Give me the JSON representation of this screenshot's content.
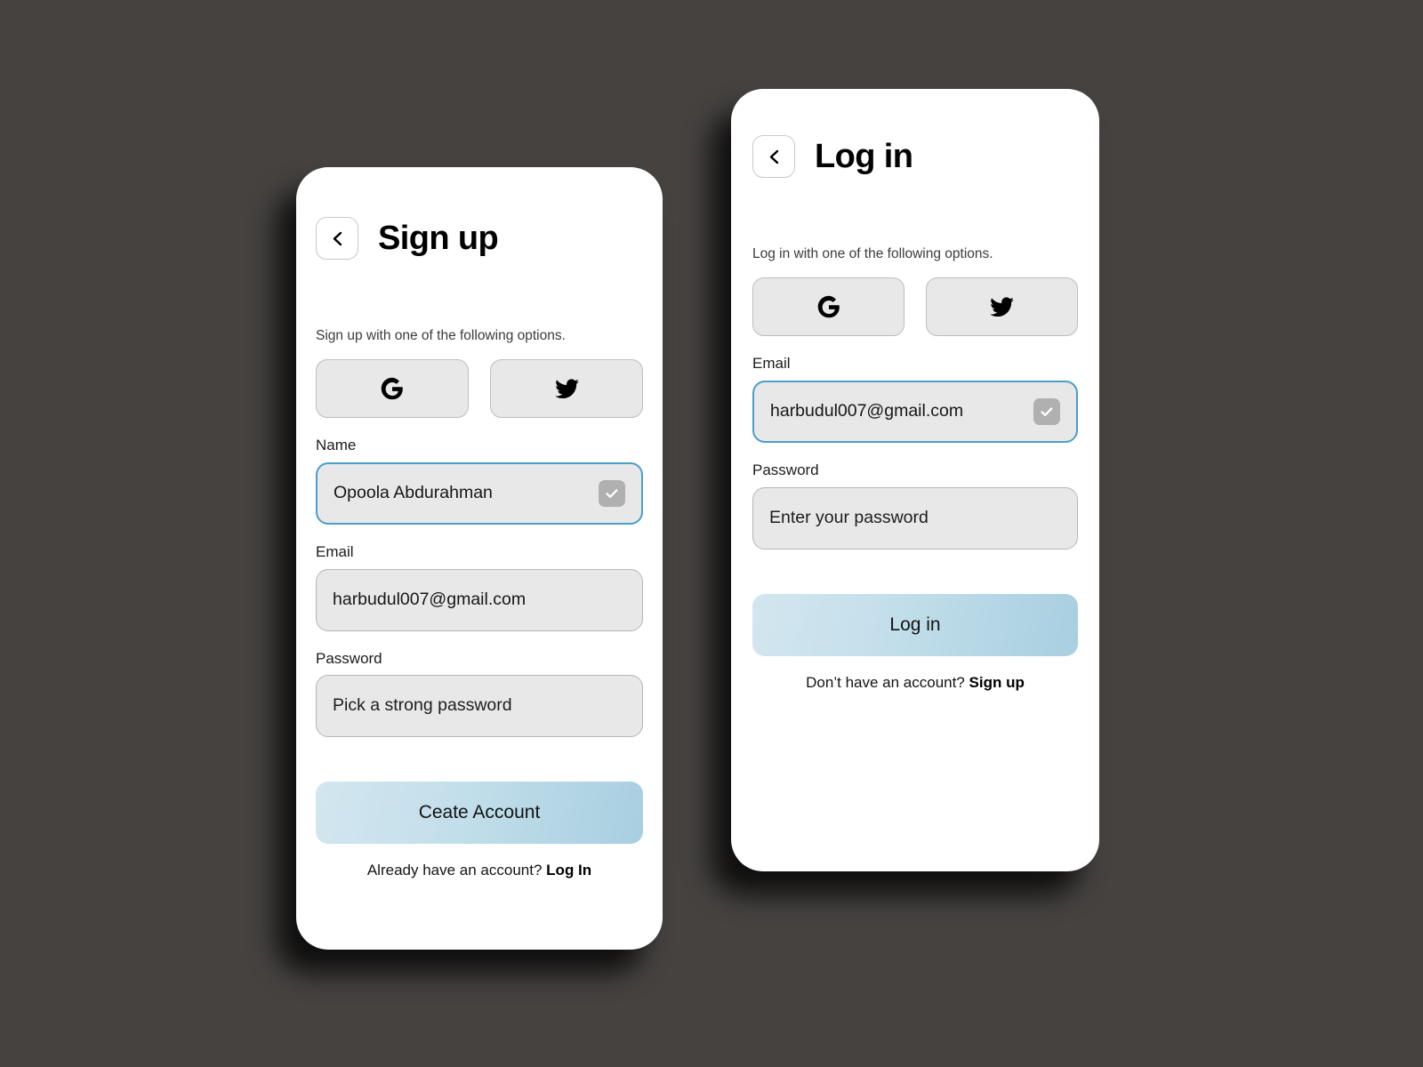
{
  "background_color": "#454240",
  "accent_color": "#4a9ec9",
  "cards": {
    "signup": {
      "title": "Sign up",
      "back_icon": "chevron-left-icon",
      "subtitle": "Sign up with one of the following options.",
      "social": [
        {
          "name": "google",
          "icon": "google-icon"
        },
        {
          "name": "twitter",
          "icon": "twitter-icon"
        }
      ],
      "fields": [
        {
          "label": "Name",
          "value": "Opoola Abdurahman",
          "is_placeholder": false,
          "focused": true,
          "has_check": true
        },
        {
          "label": "Email",
          "value": "harbudul007@gmail.com",
          "is_placeholder": false,
          "focused": false,
          "has_check": false
        },
        {
          "label": "Password",
          "value": "Pick a strong password",
          "is_placeholder": true,
          "focused": false,
          "has_check": false
        }
      ],
      "cta_label": "Ceate Account",
      "footer_text": "Already have an account?",
      "footer_link": "Log In"
    },
    "login": {
      "title": "Log in",
      "back_icon": "chevron-left-icon",
      "subtitle": "Log in with one of the following options.",
      "social": [
        {
          "name": "google",
          "icon": "google-icon"
        },
        {
          "name": "twitter",
          "icon": "twitter-icon"
        }
      ],
      "fields": [
        {
          "label": "Email",
          "value": "harbudul007@gmail.com",
          "is_placeholder": false,
          "focused": true,
          "has_check": true
        },
        {
          "label": "Password",
          "value": "Enter your password",
          "is_placeholder": true,
          "focused": false,
          "has_check": false
        }
      ],
      "cta_label": "Log in",
      "footer_text": "Don’t have an account?",
      "footer_link": "Sign up"
    }
  }
}
